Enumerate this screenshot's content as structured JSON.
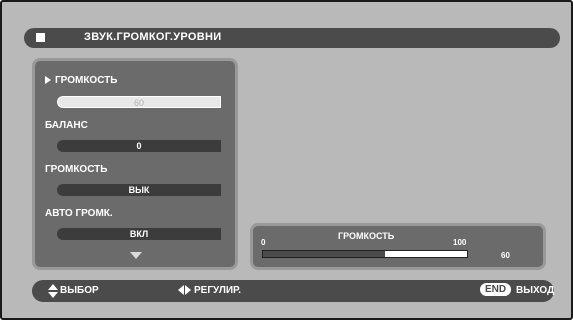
{
  "menu": {
    "title": "ЗВУК.ГРОМКОГ.УРОВНИ",
    "items": [
      {
        "label": "ГРОМКОСТЬ",
        "value": "60"
      },
      {
        "label": "БАЛАНС",
        "value": "0"
      },
      {
        "label": "ГРОМКОСТЬ",
        "value": "ВЫК"
      },
      {
        "label": "АВТО ГРОМК.",
        "value": "ВКЛ"
      }
    ]
  },
  "volume_panel": {
    "title": "ГРОМКОСТЬ",
    "min": "0",
    "max": "100",
    "value": "60",
    "level": 60
  },
  "footer": {
    "select_label": "ВЫБОР",
    "adjust_label": "РЕГУЛИР.",
    "end_key": "END",
    "exit_label": "ВЫХОД"
  },
  "colors": {
    "background": "#b9b9b9",
    "bar": "#4b4b4b",
    "panel": "#6b6b6b"
  }
}
